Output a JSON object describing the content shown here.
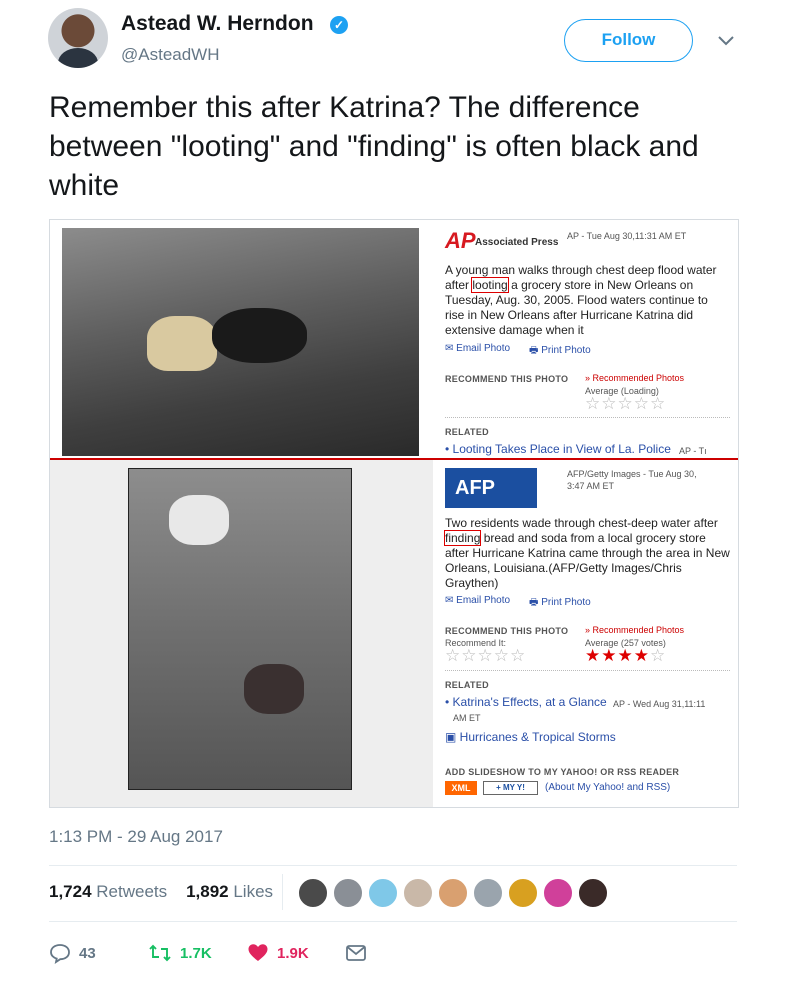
{
  "author": {
    "name": "Astead W. Herndon",
    "handle": "@AsteadWH",
    "verified_glyph": "✓",
    "follow_label": "Follow"
  },
  "tweet": {
    "text": "Remember this after Katrina? The difference between \"looting\" and \"finding\" is often black and white",
    "timestamp": "1:13 PM - 29 Aug 2017"
  },
  "media": {
    "top": {
      "logo": "AP",
      "source": "Associated Press",
      "meta": "AP - Tue Aug 30,11:31 AM ET",
      "caption_before": "A young man walks through chest deep flood water after ",
      "caption_highlight": "looting",
      "caption_after": " a grocery store in New Orleans on Tuesday, Aug. 30, 2005. Flood waters continue to rise in New Orleans after Hurricane Katrina did extensive damage when it",
      "email_photo": "Email Photo",
      "print_photo": "Print Photo",
      "recommend_heading": "RECOMMEND THIS PHOTO",
      "recommended_link": "» Recommended Photos",
      "average": "Average (Loading)",
      "stars": "☆☆☆☆☆",
      "related_heading": "RELATED",
      "related_link": "• Looting Takes Place in View of La. Police",
      "related_meta": "AP - Tı"
    },
    "bottom": {
      "logo": "AFP",
      "meta_line1": "AFP/Getty Images - Tue Aug 30,",
      "meta_line2": "3:47 AM ET",
      "caption_before": "Two residents wade through chest-deep water after ",
      "caption_highlight": "finding",
      "caption_after": " bread and soda from a local grocery store after Hurricane Katrina came through the area in New Orleans, Louisiana.(AFP/Getty Images/Chris Graythen)",
      "email_photo": "Email Photo",
      "print_photo": "Print Photo",
      "recommend_heading": "RECOMMEND THIS PHOTO",
      "recommended_link": "» Recommended Photos",
      "recommend_it": "Recommend It:",
      "average": "Average (257 votes)",
      "stars_empty": "☆☆☆☆☆",
      "stars_rating_filled": "★★★★",
      "stars_rating_empty": "☆",
      "rating_value": 4,
      "related_heading": "RELATED",
      "related_link": "• Katrina's Effects, at a Glance",
      "related_meta_1": "AP - Wed Aug 31,11:11",
      "related_meta_2": "AM ET",
      "hurricanes_link": "Hurricanes & Tropical Storms",
      "slideshow_heading": "ADD SLIDESHOW TO MY YAHOO! OR RSS READER",
      "xml_label": "XML",
      "myy_label": "+ MY Y!",
      "about_link": "(About My Yahoo! and RSS)"
    }
  },
  "stats": {
    "retweets_count": "1,724",
    "retweets_label": "Retweets",
    "likes_count": "1,892",
    "likes_label": "Likes",
    "liker_colors": [
      "#4a4a4a",
      "#8a8f96",
      "#7fc8e8",
      "#c9b8a8",
      "#d9a070",
      "#9aa4ad",
      "#d8a020",
      "#d0409a",
      "#3a2a28"
    ]
  },
  "actions": {
    "reply_count": "43",
    "retweet_count": "1.7K",
    "like_count": "1.9K"
  },
  "colors": {
    "accent": "#1da1f2",
    "retweet_green": "#17bf63",
    "like_red": "#e0245e",
    "muted": "#657786"
  }
}
